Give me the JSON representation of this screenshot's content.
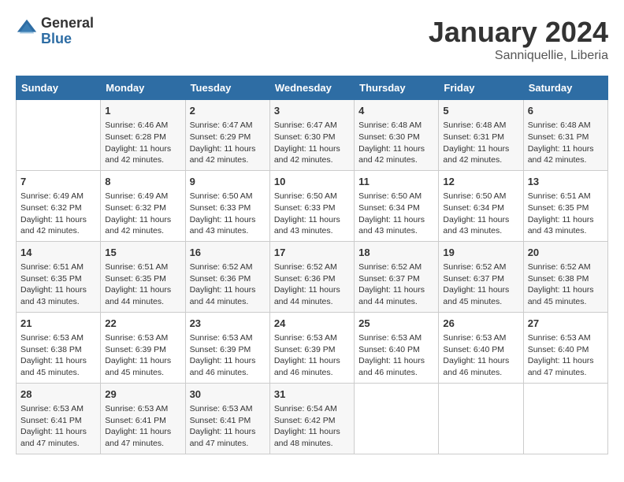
{
  "logo": {
    "general": "General",
    "blue": "Blue"
  },
  "title": "January 2024",
  "location": "Sanniquellie, Liberia",
  "days_of_week": [
    "Sunday",
    "Monday",
    "Tuesday",
    "Wednesday",
    "Thursday",
    "Friday",
    "Saturday"
  ],
  "weeks": [
    [
      {
        "day": "",
        "sunrise": "",
        "sunset": "",
        "daylight": ""
      },
      {
        "day": "1",
        "sunrise": "Sunrise: 6:46 AM",
        "sunset": "Sunset: 6:28 PM",
        "daylight": "Daylight: 11 hours and 42 minutes."
      },
      {
        "day": "2",
        "sunrise": "Sunrise: 6:47 AM",
        "sunset": "Sunset: 6:29 PM",
        "daylight": "Daylight: 11 hours and 42 minutes."
      },
      {
        "day": "3",
        "sunrise": "Sunrise: 6:47 AM",
        "sunset": "Sunset: 6:30 PM",
        "daylight": "Daylight: 11 hours and 42 minutes."
      },
      {
        "day": "4",
        "sunrise": "Sunrise: 6:48 AM",
        "sunset": "Sunset: 6:30 PM",
        "daylight": "Daylight: 11 hours and 42 minutes."
      },
      {
        "day": "5",
        "sunrise": "Sunrise: 6:48 AM",
        "sunset": "Sunset: 6:31 PM",
        "daylight": "Daylight: 11 hours and 42 minutes."
      },
      {
        "day": "6",
        "sunrise": "Sunrise: 6:48 AM",
        "sunset": "Sunset: 6:31 PM",
        "daylight": "Daylight: 11 hours and 42 minutes."
      }
    ],
    [
      {
        "day": "7",
        "sunrise": "Sunrise: 6:49 AM",
        "sunset": "Sunset: 6:32 PM",
        "daylight": "Daylight: 11 hours and 42 minutes."
      },
      {
        "day": "8",
        "sunrise": "Sunrise: 6:49 AM",
        "sunset": "Sunset: 6:32 PM",
        "daylight": "Daylight: 11 hours and 42 minutes."
      },
      {
        "day": "9",
        "sunrise": "Sunrise: 6:50 AM",
        "sunset": "Sunset: 6:33 PM",
        "daylight": "Daylight: 11 hours and 43 minutes."
      },
      {
        "day": "10",
        "sunrise": "Sunrise: 6:50 AM",
        "sunset": "Sunset: 6:33 PM",
        "daylight": "Daylight: 11 hours and 43 minutes."
      },
      {
        "day": "11",
        "sunrise": "Sunrise: 6:50 AM",
        "sunset": "Sunset: 6:34 PM",
        "daylight": "Daylight: 11 hours and 43 minutes."
      },
      {
        "day": "12",
        "sunrise": "Sunrise: 6:50 AM",
        "sunset": "Sunset: 6:34 PM",
        "daylight": "Daylight: 11 hours and 43 minutes."
      },
      {
        "day": "13",
        "sunrise": "Sunrise: 6:51 AM",
        "sunset": "Sunset: 6:35 PM",
        "daylight": "Daylight: 11 hours and 43 minutes."
      }
    ],
    [
      {
        "day": "14",
        "sunrise": "Sunrise: 6:51 AM",
        "sunset": "Sunset: 6:35 PM",
        "daylight": "Daylight: 11 hours and 43 minutes."
      },
      {
        "day": "15",
        "sunrise": "Sunrise: 6:51 AM",
        "sunset": "Sunset: 6:35 PM",
        "daylight": "Daylight: 11 hours and 44 minutes."
      },
      {
        "day": "16",
        "sunrise": "Sunrise: 6:52 AM",
        "sunset": "Sunset: 6:36 PM",
        "daylight": "Daylight: 11 hours and 44 minutes."
      },
      {
        "day": "17",
        "sunrise": "Sunrise: 6:52 AM",
        "sunset": "Sunset: 6:36 PM",
        "daylight": "Daylight: 11 hours and 44 minutes."
      },
      {
        "day": "18",
        "sunrise": "Sunrise: 6:52 AM",
        "sunset": "Sunset: 6:37 PM",
        "daylight": "Daylight: 11 hours and 44 minutes."
      },
      {
        "day": "19",
        "sunrise": "Sunrise: 6:52 AM",
        "sunset": "Sunset: 6:37 PM",
        "daylight": "Daylight: 11 hours and 45 minutes."
      },
      {
        "day": "20",
        "sunrise": "Sunrise: 6:52 AM",
        "sunset": "Sunset: 6:38 PM",
        "daylight": "Daylight: 11 hours and 45 minutes."
      }
    ],
    [
      {
        "day": "21",
        "sunrise": "Sunrise: 6:53 AM",
        "sunset": "Sunset: 6:38 PM",
        "daylight": "Daylight: 11 hours and 45 minutes."
      },
      {
        "day": "22",
        "sunrise": "Sunrise: 6:53 AM",
        "sunset": "Sunset: 6:39 PM",
        "daylight": "Daylight: 11 hours and 45 minutes."
      },
      {
        "day": "23",
        "sunrise": "Sunrise: 6:53 AM",
        "sunset": "Sunset: 6:39 PM",
        "daylight": "Daylight: 11 hours and 46 minutes."
      },
      {
        "day": "24",
        "sunrise": "Sunrise: 6:53 AM",
        "sunset": "Sunset: 6:39 PM",
        "daylight": "Daylight: 11 hours and 46 minutes."
      },
      {
        "day": "25",
        "sunrise": "Sunrise: 6:53 AM",
        "sunset": "Sunset: 6:40 PM",
        "daylight": "Daylight: 11 hours and 46 minutes."
      },
      {
        "day": "26",
        "sunrise": "Sunrise: 6:53 AM",
        "sunset": "Sunset: 6:40 PM",
        "daylight": "Daylight: 11 hours and 46 minutes."
      },
      {
        "day": "27",
        "sunrise": "Sunrise: 6:53 AM",
        "sunset": "Sunset: 6:40 PM",
        "daylight": "Daylight: 11 hours and 47 minutes."
      }
    ],
    [
      {
        "day": "28",
        "sunrise": "Sunrise: 6:53 AM",
        "sunset": "Sunset: 6:41 PM",
        "daylight": "Daylight: 11 hours and 47 minutes."
      },
      {
        "day": "29",
        "sunrise": "Sunrise: 6:53 AM",
        "sunset": "Sunset: 6:41 PM",
        "daylight": "Daylight: 11 hours and 47 minutes."
      },
      {
        "day": "30",
        "sunrise": "Sunrise: 6:53 AM",
        "sunset": "Sunset: 6:41 PM",
        "daylight": "Daylight: 11 hours and 47 minutes."
      },
      {
        "day": "31",
        "sunrise": "Sunrise: 6:54 AM",
        "sunset": "Sunset: 6:42 PM",
        "daylight": "Daylight: 11 hours and 48 minutes."
      },
      {
        "day": "",
        "sunrise": "",
        "sunset": "",
        "daylight": ""
      },
      {
        "day": "",
        "sunrise": "",
        "sunset": "",
        "daylight": ""
      },
      {
        "day": "",
        "sunrise": "",
        "sunset": "",
        "daylight": ""
      }
    ]
  ]
}
